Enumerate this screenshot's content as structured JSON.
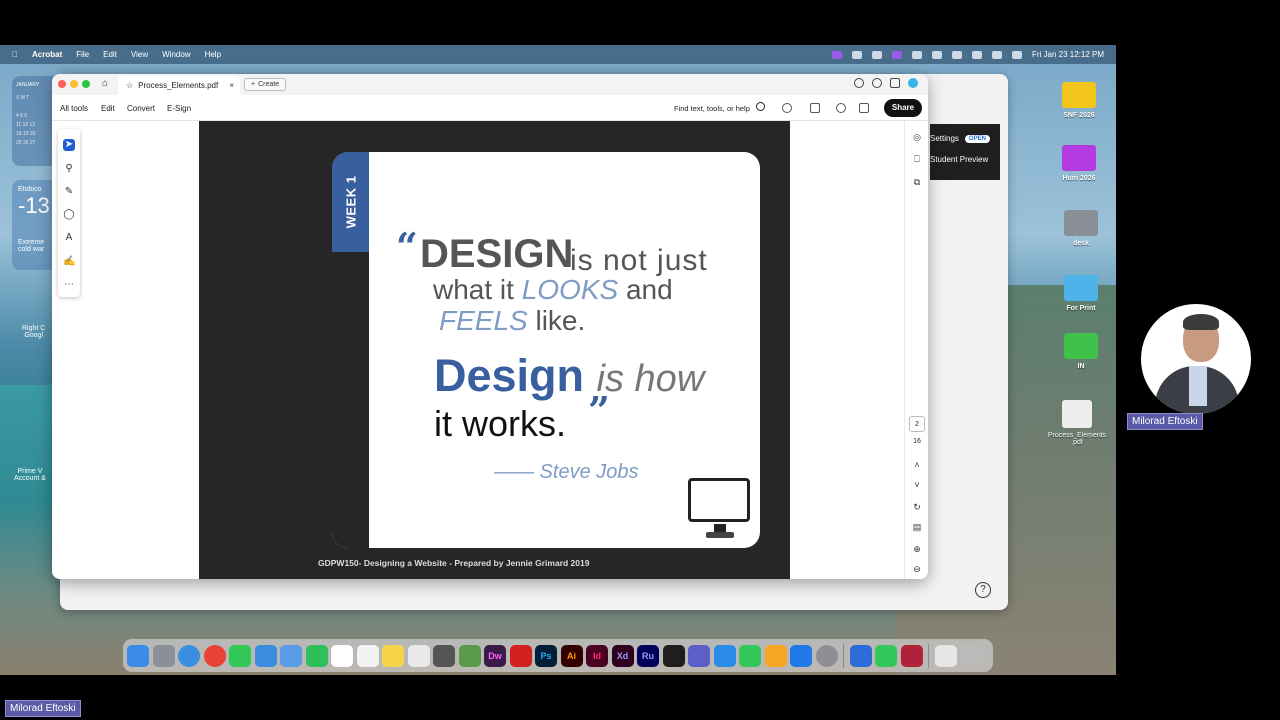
{
  "menubar": {
    "app": "Acrobat",
    "items": [
      "File",
      "Edit",
      "View",
      "Window",
      "Help"
    ],
    "clock": "Fri Jan 23  12:12 PM"
  },
  "widgets": {
    "calendar_month": "JANUARY",
    "weather_title": "Etobico",
    "weather_temp": "-13",
    "weather_desc1": "Extreme",
    "weather_desc2": "cold war"
  },
  "desktop_left": {
    "label1a": "Right C",
    "label1b": "Googl",
    "label2a": "Prime V",
    "label2b": "Account &"
  },
  "desktop_icons": [
    {
      "label": "SNF 2026",
      "color": "#f2c51a"
    },
    {
      "label": "Hum 2026",
      "color": "#b33be0"
    },
    {
      "label": "desk",
      "color": "#8a8f96"
    },
    {
      "label": "For Print",
      "color": "#4fb3ea"
    },
    {
      "label": "IN",
      "color": "#3fc24a"
    },
    {
      "label": "Process_Elements .pdf",
      "color": "#eeeeee"
    }
  ],
  "back_window": {
    "settings": "Settings",
    "open_badge": "OPEN",
    "student_preview": "Student Preview"
  },
  "acrobat": {
    "tab_title": "Process_Elements.pdf",
    "create_label": "Create",
    "menu": [
      "All tools",
      "Edit",
      "Convert",
      "E-Sign"
    ],
    "find_placeholder": "Find text, tools, or help",
    "share_label": "Share",
    "current_page": "2",
    "page_count": "16"
  },
  "slide": {
    "week": "WEEK 1",
    "quote_open": "“",
    "q_design": "DESIGN",
    "q_line1_rest": "is not just",
    "q_line2_a": "what it ",
    "q_line2_looks": "LOOKS",
    "q_line2_b": " and",
    "q_line3_feels": "FEELS",
    "q_line3_b": " like.",
    "q_design2": "Design ",
    "q_ishow": "is how",
    "q_works": "it works.",
    "quote_close": "”",
    "author": "—— Steve Jobs",
    "caption": "GDPW150- Designing a Website  - Prepared by Jennie Grimard 2019"
  },
  "presenter": {
    "name": "Milorad Eftoski",
    "footer_name": "Milorad Eftoski"
  }
}
